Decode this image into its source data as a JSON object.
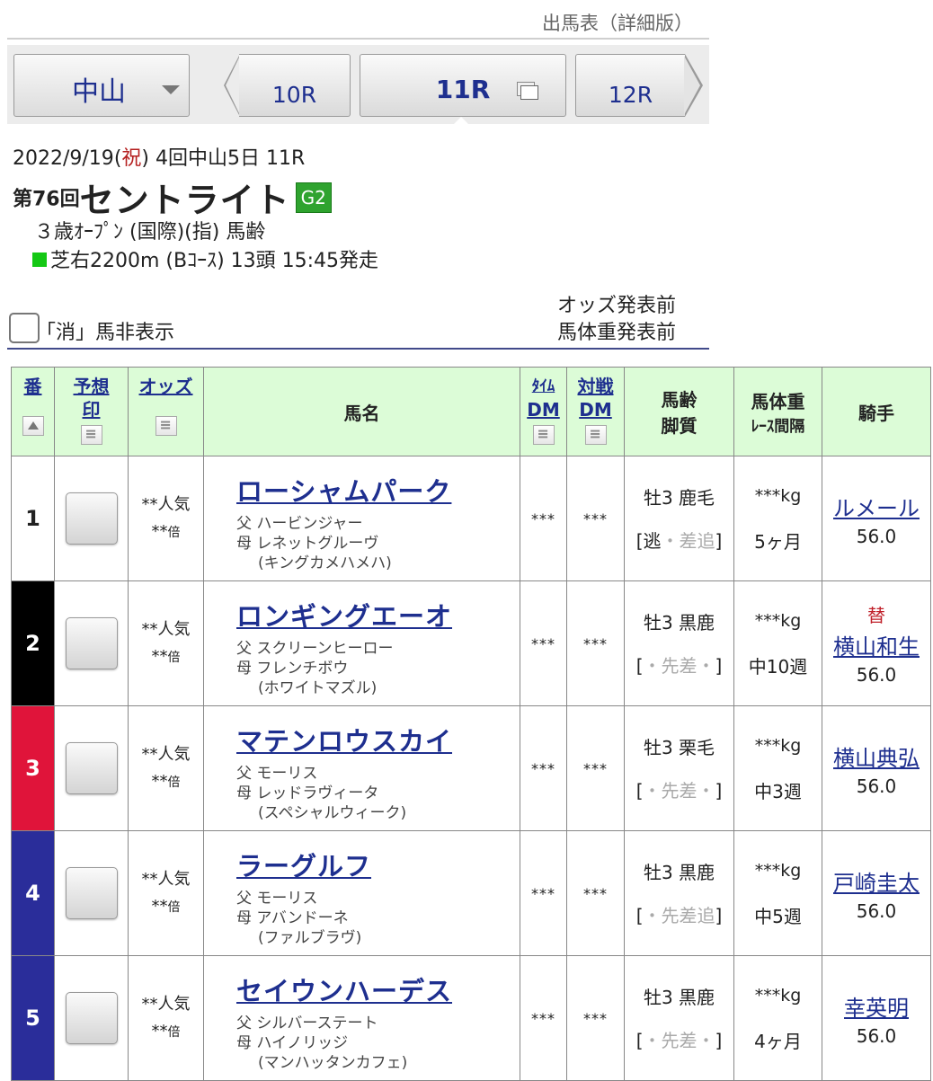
{
  "page_title": "出馬表（詳細版）",
  "nav": {
    "venue": "中山",
    "prev_race": "10R",
    "current_race": "11R",
    "next_race": "12R"
  },
  "race": {
    "date": "2022/9/19",
    "holiday": "祝",
    "meeting": "4回中山5日 11R",
    "number": "第76回",
    "name": "セントライト",
    "grade": "G2",
    "conditions": "３歳ｵｰﾌﾟﾝ (国際)(指) 馬齢",
    "course": "芝右2200m (Bｺｰｽ) 13頭 15:45発走"
  },
  "controls": {
    "hide_scratched": "「消」馬非表示",
    "odds_status": "オッズ発表前",
    "weight_status": "馬体重発表前"
  },
  "headers": {
    "num": "番",
    "mark1": "予想",
    "mark2": "印",
    "odds": "オッズ",
    "horse": "馬名",
    "time1": "ﾀｲﾑ",
    "time2": "DM",
    "vs1": "対戦",
    "vs2": "DM",
    "age1": "馬齢",
    "age2": "脚質",
    "weight1": "馬体重",
    "weight2": "ﾚｰｽ間隔",
    "jockey": "騎手"
  },
  "entries": [
    {
      "num": "1",
      "odds1": "**人気",
      "odds2": "**",
      "odds_unit": "倍",
      "name": "ローシャムパーク",
      "sire": "父 ハービンジャー",
      "dam": "母 レネットグルーヴ",
      "damsire": "(キングカメハメハ)",
      "time_dm": "***",
      "vs_dm": "***",
      "age": "牡3 鹿毛",
      "style_open": "[",
      "style_a": "逃",
      "style_b": "・",
      "style_c": "差追",
      "style_close": "]",
      "weight": "***kg",
      "interval": "5ヶ月",
      "change": "",
      "jockey": "ルメール",
      "jweight": "56.0"
    },
    {
      "num": "2",
      "odds1": "**人気",
      "odds2": "**",
      "odds_unit": "倍",
      "name": "ロンギングエーオ",
      "sire": "父 スクリーンヒーロー",
      "dam": "母 フレンチボウ",
      "damsire": "(ホワイトマズル)",
      "time_dm": "***",
      "vs_dm": "***",
      "age": "牡3 黒鹿",
      "style_open": "[",
      "style_a": "・先",
      "style_b": "差",
      "style_c": "・",
      "style_close": "]",
      "weight": "***kg",
      "interval": "中10週",
      "change": "替",
      "jockey": "横山和生",
      "jweight": "56.0"
    },
    {
      "num": "3",
      "odds1": "**人気",
      "odds2": "**",
      "odds_unit": "倍",
      "name": "マテンロウスカイ",
      "sire": "父 モーリス",
      "dam": "母 レッドラヴィータ",
      "damsire": "(スペシャルウィーク)",
      "time_dm": "***",
      "vs_dm": "***",
      "age": "牡3 栗毛",
      "style_open": "[",
      "style_a": "・先差・",
      "style_b": "",
      "style_c": "",
      "style_close": "]",
      "weight": "***kg",
      "interval": "中3週",
      "change": "",
      "jockey": "横山典弘",
      "jweight": "56.0"
    },
    {
      "num": "4",
      "odds1": "**人気",
      "odds2": "**",
      "odds_unit": "倍",
      "name": "ラーグルフ",
      "sire": "父 モーリス",
      "dam": "母 アバンドーネ",
      "damsire": "(ファルブラヴ)",
      "time_dm": "***",
      "vs_dm": "***",
      "age": "牡3 黒鹿",
      "style_open": "[",
      "style_a": "・先差追",
      "style_b": "",
      "style_c": "",
      "style_close": "]",
      "weight": "***kg",
      "interval": "中5週",
      "change": "",
      "jockey": "戸崎圭太",
      "jweight": "56.0"
    },
    {
      "num": "5",
      "odds1": "**人気",
      "odds2": "**",
      "odds_unit": "倍",
      "name": "セイウンハーデス",
      "sire": "父 シルバーステート",
      "dam": "母 ハイノリッジ",
      "damsire": "(マンハッタンカフェ)",
      "time_dm": "***",
      "vs_dm": "***",
      "age": "牡3 黒鹿",
      "style_open": "[",
      "style_a": "・",
      "style_b": "先",
      "style_c": "差・",
      "style_close": "]",
      "weight": "***kg",
      "interval": "4ヶ月",
      "change": "",
      "jockey": "幸英明",
      "jweight": "56.0"
    }
  ],
  "colors": {
    "header_bg": "#dcfcd7",
    "link": "#1e2f8f",
    "waku_1": "#ffffff",
    "waku_2": "#000000",
    "waku_3": "#e0143a",
    "waku_4": "#2a2d9a",
    "waku_5": "#2a2d9a",
    "grade_g2": "#2fa32f"
  }
}
